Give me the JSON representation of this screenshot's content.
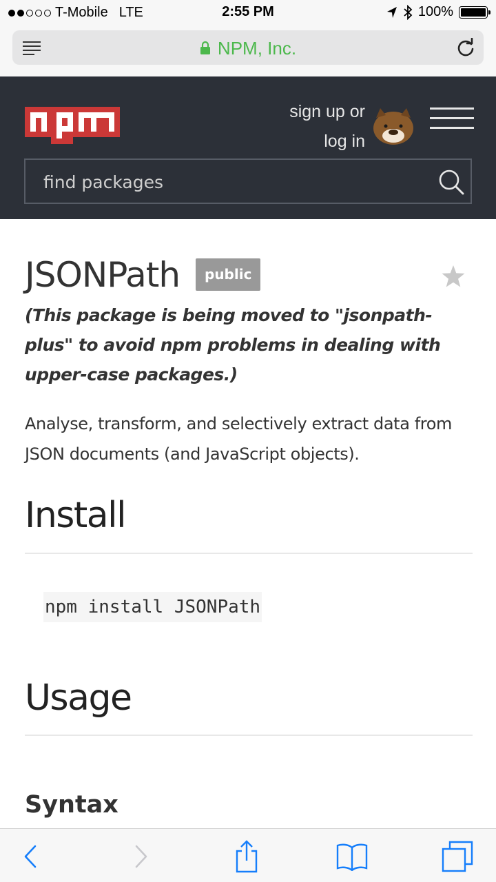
{
  "status_bar": {
    "carrier": "T-Mobile",
    "network": "LTE",
    "time": "2:55 PM",
    "battery": "100%",
    "signal_bars_filled": 2,
    "signal_bars_total": 5
  },
  "safari": {
    "url_text": "NPM, Inc.",
    "url_color": "#4cb84c",
    "icons": [
      "reader-icon",
      "lock-icon",
      "reload-icon"
    ]
  },
  "header": {
    "logo_text": "npm",
    "brand_color": "#cb3837",
    "auth_line1": "sign up or",
    "auth_line2": "log in",
    "search_placeholder": "find packages",
    "background": "#2c3038"
  },
  "package": {
    "name": "JSONPath",
    "badge": "public",
    "notice": "(This package is being moved to \"jsonpath-plus\" to avoid npm problems in dealing with upper-case packages.)",
    "description": "Analyse, transform, and selectively extract data from JSON documents (and JavaScript objects)."
  },
  "readme": {
    "install_heading": "Install",
    "install_command": "npm install JSONPath",
    "usage_heading": "Usage",
    "syntax_heading": "Syntax"
  },
  "toolbar": {
    "items": [
      "back-icon",
      "forward-icon",
      "share-icon",
      "bookmarks-icon",
      "tabs-icon"
    ],
    "active_color": "#157efb",
    "disabled_color": "#c8c8cc"
  }
}
